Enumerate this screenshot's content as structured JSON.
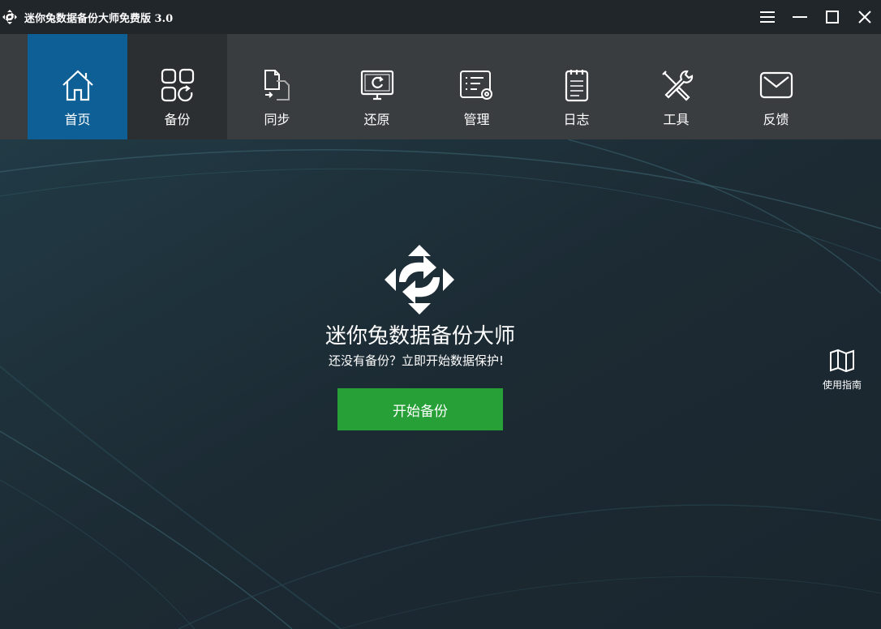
{
  "window": {
    "title": "迷你兔数据备份大师免费版 3.0",
    "controls": [
      "menu-icon",
      "minimize-icon",
      "maximize-icon",
      "close-icon"
    ]
  },
  "nav": {
    "items": [
      {
        "label": "首页",
        "icon": "home-icon",
        "active": true
      },
      {
        "label": "备份",
        "icon": "backup-icon",
        "active": false
      },
      {
        "label": "同步",
        "icon": "sync-icon",
        "active": false
      },
      {
        "label": "还原",
        "icon": "restore-icon",
        "active": false
      },
      {
        "label": "管理",
        "icon": "manage-icon",
        "active": false
      },
      {
        "label": "日志",
        "icon": "log-icon",
        "active": false
      },
      {
        "label": "工具",
        "icon": "tools-icon",
        "active": false
      },
      {
        "label": "反馈",
        "icon": "feedback-icon",
        "active": false
      }
    ]
  },
  "main": {
    "title": "迷你兔数据备份大师",
    "subtitle": "还没有备份？立即开始数据保护!",
    "start_button": "开始备份",
    "guide_label": "使用指南"
  },
  "colors": {
    "titlebar": "#21262b",
    "navbar": "#3a3d40",
    "nav_active": "#0d5f95",
    "background": "#1c2a33",
    "button": "#27a037"
  }
}
